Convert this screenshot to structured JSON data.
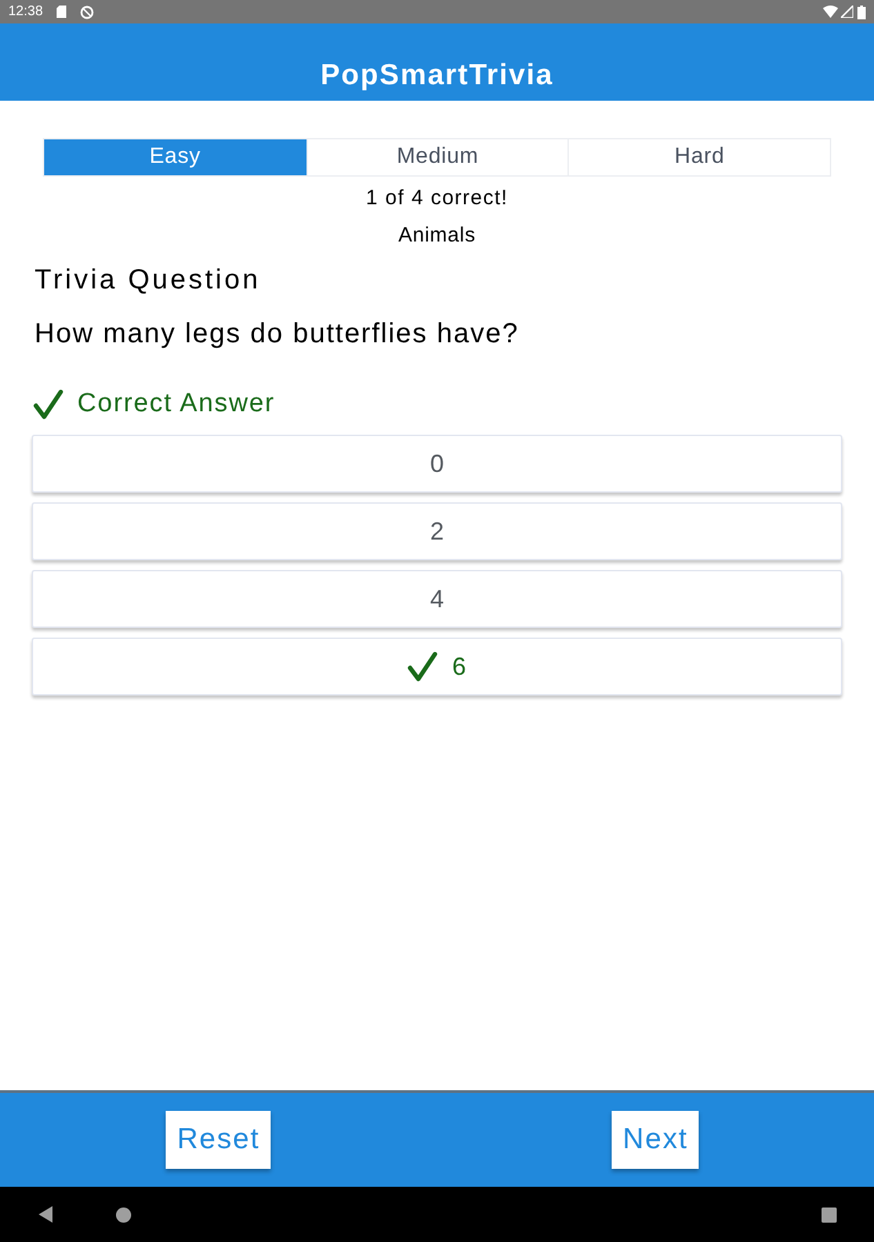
{
  "status_bar": {
    "time": "12:38"
  },
  "app_bar": {
    "title": "PopSmartTrivia"
  },
  "difficulty_tabs": [
    {
      "label": "Easy",
      "selected": true
    },
    {
      "label": "Medium",
      "selected": false
    },
    {
      "label": "Hard",
      "selected": false
    }
  ],
  "score": "1 of 4 correct!",
  "category": "Animals",
  "heading": "Trivia Question",
  "question": "How many legs do butterflies have?",
  "result": {
    "kind": "correct",
    "label": "Correct Answer"
  },
  "answers": [
    {
      "label": "0",
      "correct": false
    },
    {
      "label": "2",
      "correct": false
    },
    {
      "label": "4",
      "correct": false
    },
    {
      "label": "6",
      "correct": true
    }
  ],
  "bottom_buttons": [
    "Reset",
    "Next"
  ]
}
